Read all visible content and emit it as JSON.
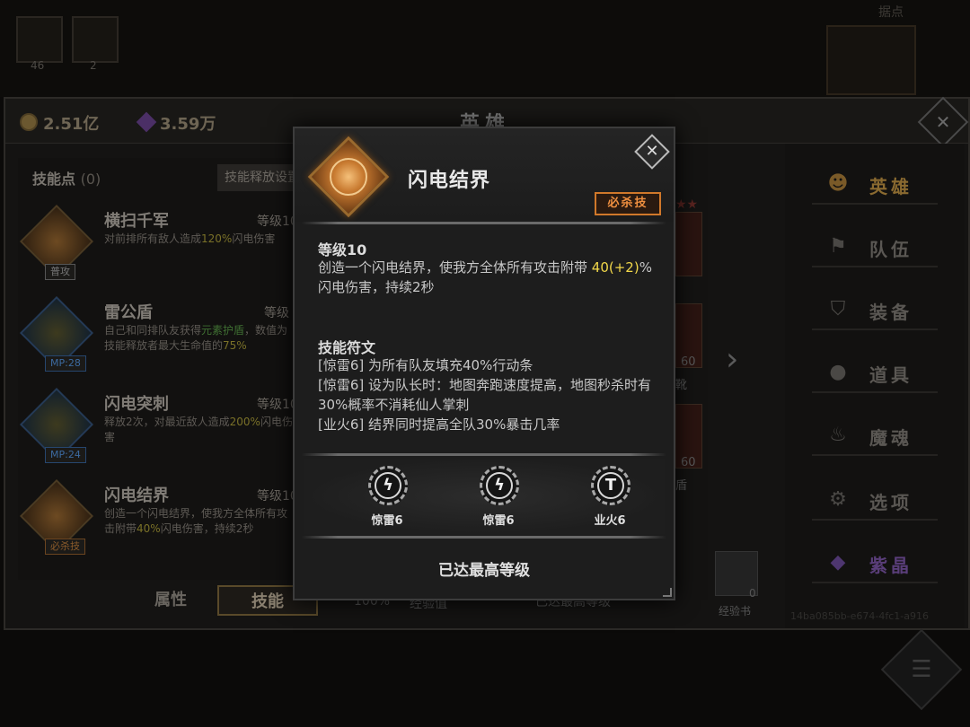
{
  "background": {
    "top_slots": [
      {
        "count": "46"
      },
      {
        "count": "2"
      }
    ],
    "map_label": "据点",
    "resources": {
      "gold": "2.51亿",
      "gems": "3.59万"
    },
    "screen_title": "英雄",
    "skill_points_label": "技能点",
    "skill_points_value": "(0)",
    "release_settings_label": "技能释放设置",
    "skills": [
      {
        "name": "横扫千军",
        "level": "等级10",
        "tag": "普攻",
        "desc_pre": "对前排所有敌人造成",
        "desc_hl": "120%",
        "desc_post": "闪电伤害"
      },
      {
        "name": "雷公盾",
        "level": "等级",
        "tag": "MP:28",
        "desc_pre": "自己和同排队友获得",
        "desc_hl": "元素护盾",
        "desc_post": "，数值为技能释放者最大生命值的",
        "desc_hl2": "75%"
      },
      {
        "name": "闪电突刺",
        "level": "等级10",
        "tag": "MP:24",
        "desc_pre": "释放2次，对最近敌人造成",
        "desc_hl": "200%",
        "desc_post": "闪电伤害"
      },
      {
        "name": "闪电结界",
        "level": "等级10",
        "tag": "必杀技",
        "desc_pre": "创造一个闪电结界，使我方全体所有攻击附带",
        "desc_hl": "40%",
        "desc_post": "闪电伤害，持续2秒"
      }
    ],
    "bottom_tabs": {
      "attributes": "属性",
      "skills": "技能"
    },
    "exp_percent": "100%",
    "exp_label": "经验值",
    "exp_max": "已达最高等级",
    "equip_values": [
      "60",
      "60"
    ],
    "equip_labels": [
      "靴",
      "盾"
    ],
    "nav": [
      {
        "label": "英雄",
        "icon": "person-icon"
      },
      {
        "label": "队伍",
        "icon": "flag-icon"
      },
      {
        "label": "装备",
        "icon": "helmet-icon"
      },
      {
        "label": "道具",
        "icon": "bag-icon"
      },
      {
        "label": "魔魂",
        "icon": "flame-icon"
      },
      {
        "label": "选项",
        "icon": "gear-icon"
      },
      {
        "label": "紫晶",
        "icon": "crystal-icon"
      }
    ],
    "exp_book_count": "0",
    "exp_book_label": "经验书",
    "hero_id": "14ba085bb-e674-4fc1-a916"
  },
  "modal": {
    "title": "闪电结界",
    "badge": "必杀技",
    "level": "等级10",
    "desc_pre": "创造一个闪电结界，使我方全体所有攻击附带 ",
    "desc_value": "40(+2)",
    "desc_post": "%闪电伤害，持续2秒",
    "rune_title": "技能符文",
    "rune_lines": [
      "[惊雷6] 为所有队友填充40%行动条",
      "[惊雷6] 设为队长时：地图奔跑速度提高，地图秒杀时有30%概率不消耗仙人掌刺",
      "[业火6] 结界同时提高全队30%暴击几率"
    ],
    "runes": [
      {
        "name": "惊雷6",
        "glyph": "ϟ",
        "icon": "lightning-rune-icon"
      },
      {
        "name": "惊雷6",
        "glyph": "ϟ",
        "icon": "lightning-rune-icon"
      },
      {
        "name": "业火6",
        "glyph": "T",
        "icon": "fire-rune-icon"
      }
    ],
    "max_level": "已达最高等级"
  }
}
